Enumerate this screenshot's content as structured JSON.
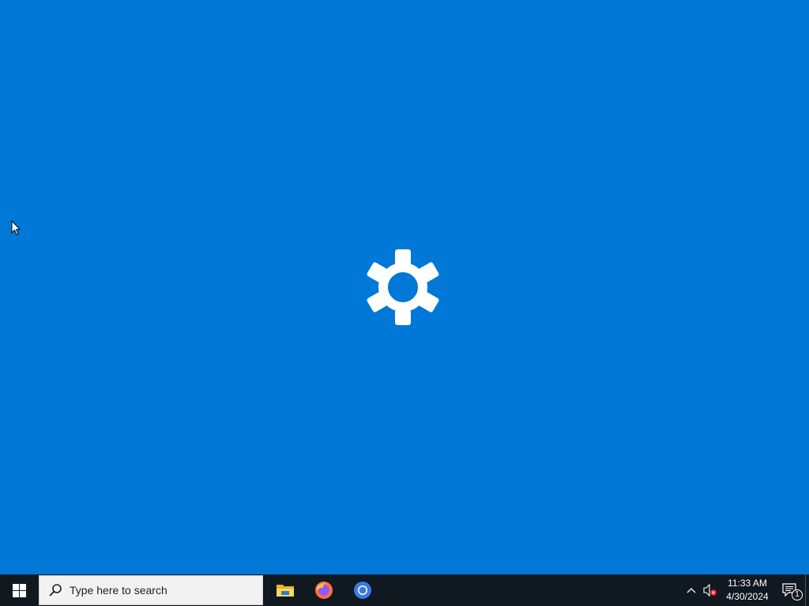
{
  "desktop": {
    "background_color": "#0078d7",
    "splash_icon": "gear-icon"
  },
  "taskbar": {
    "background_color": "#101820",
    "start_icon": "windows-logo-icon",
    "search": {
      "placeholder": "Type here to search",
      "icon": "search-icon"
    },
    "pinned_apps": [
      {
        "name": "File Explorer",
        "icon": "file-explorer-icon"
      },
      {
        "name": "Firefox",
        "icon": "firefox-icon"
      },
      {
        "name": "Chromium",
        "icon": "chromium-icon"
      }
    ],
    "tray": {
      "hidden_icons": "chevron-up-icon",
      "volume": "volume-muted-icon",
      "clock": {
        "time": "11:33 AM",
        "date": "4/30/2024"
      },
      "notifications": {
        "icon": "action-center-icon",
        "count": "1"
      }
    }
  }
}
